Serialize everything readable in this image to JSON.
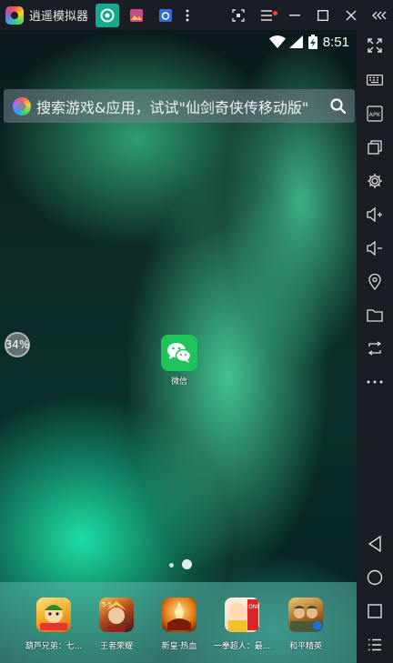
{
  "titlebar": {
    "app_title": "逍遥模拟器"
  },
  "statusbar": {
    "time": "8:51"
  },
  "search": {
    "placeholder": "搜索游戏&应用，试试\"仙剑奇侠传移动版\""
  },
  "side_widget": {
    "percent": "34%"
  },
  "home": {
    "apps": [
      {
        "label": "微信",
        "icon": "wechat-icon"
      }
    ],
    "pages": 2,
    "current_page": 2
  },
  "dock": {
    "items": [
      {
        "label": "葫芦兄弟：七...",
        "icon": "calabash-brothers-game-icon"
      },
      {
        "label": "王者荣耀",
        "icon": "honor-of-kings-game-icon"
      },
      {
        "label": "新皇·热血",
        "icon": "new-emperor-game-icon"
      },
      {
        "label": "一拳超人：最...",
        "icon": "one-punch-man-game-icon"
      },
      {
        "label": "和平精英",
        "icon": "peace-elite-game-icon"
      }
    ]
  },
  "colors": {
    "active_tab": "#13aa8e",
    "wechat": "#1ec35b",
    "titlebar_bg": "#1a1e24"
  }
}
